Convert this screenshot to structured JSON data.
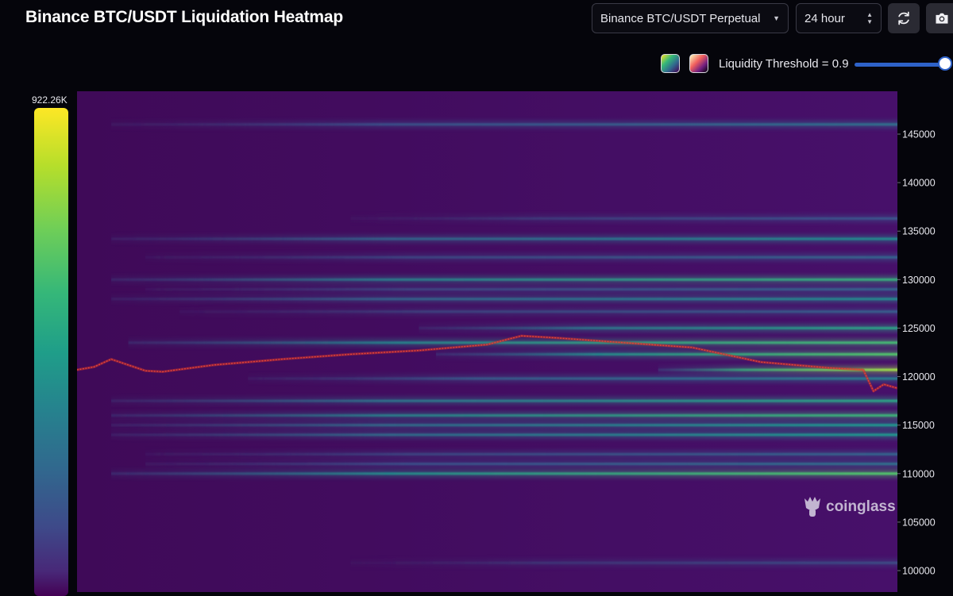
{
  "page": {
    "title": "Binance BTC/USDT Liquidation Heatmap"
  },
  "controls": {
    "market": "Binance BTC/USDT Perpetual",
    "range": "24 hour",
    "threshold_label": "Liquidity Threshold = 0.9",
    "threshold_value": 0.9
  },
  "colors": {
    "accent": "#2e62c9",
    "background": "#05050b",
    "heat_base": "#450c5e"
  },
  "icons": {
    "refresh": "refresh-icon",
    "camera": "camera-icon",
    "logo": "coinglass-logo-icon"
  },
  "watermark": "coinglass",
  "chart_data": {
    "type": "heatmap",
    "title": "Binance BTC/USDT Liquidation Heatmap",
    "colorscale": "viridis",
    "scale_max_label": "922.26K",
    "y_ticks": [
      145000,
      140000,
      135000,
      130000,
      125000,
      120000,
      115000,
      110000,
      105000,
      100000
    ],
    "y_range": [
      98000,
      149500
    ],
    "x_range": [
      0,
      24
    ],
    "grid": false,
    "liquidation_levels": [
      {
        "price": 146000,
        "start": 1.0,
        "intensity": 0.35
      },
      {
        "price": 136300,
        "start": 8.0,
        "intensity": 0.25
      },
      {
        "price": 134200,
        "start": 1.0,
        "intensity": 0.45
      },
      {
        "price": 132300,
        "start": 2.0,
        "intensity": 0.3
      },
      {
        "price": 130000,
        "start": 1.0,
        "intensity": 0.6
      },
      {
        "price": 129000,
        "start": 2.0,
        "intensity": 0.3
      },
      {
        "price": 128000,
        "start": 1.0,
        "intensity": 0.45
      },
      {
        "price": 126700,
        "start": 3.0,
        "intensity": 0.28
      },
      {
        "price": 125000,
        "start": 10.0,
        "intensity": 0.55
      },
      {
        "price": 123500,
        "start": 1.5,
        "intensity": 0.65
      },
      {
        "price": 122300,
        "start": 10.5,
        "intensity": 0.7
      },
      {
        "price": 120700,
        "start": 17.0,
        "intensity": 0.85
      },
      {
        "price": 119800,
        "start": 5.0,
        "intensity": 0.4
      },
      {
        "price": 117500,
        "start": 1.0,
        "intensity": 0.55
      },
      {
        "price": 116000,
        "start": 1.0,
        "intensity": 0.62
      },
      {
        "price": 115000,
        "start": 1.0,
        "intensity": 0.5
      },
      {
        "price": 114000,
        "start": 1.0,
        "intensity": 0.5
      },
      {
        "price": 112000,
        "start": 2.0,
        "intensity": 0.3
      },
      {
        "price": 111000,
        "start": 2.0,
        "intensity": 0.35
      },
      {
        "price": 110000,
        "start": 1.0,
        "intensity": 0.7
      },
      {
        "price": 100800,
        "start": 8.0,
        "intensity": 0.22
      }
    ],
    "price_series": {
      "x": [
        0,
        0.5,
        1,
        2,
        2.5,
        4,
        6,
        8,
        10,
        12,
        13,
        14,
        16,
        18,
        20,
        22,
        23,
        23.3,
        23.6,
        24
      ],
      "y": [
        120700,
        121000,
        121800,
        120600,
        120500,
        121200,
        121800,
        122300,
        122700,
        123300,
        124200,
        124000,
        123500,
        123000,
        121500,
        120900,
        120700,
        118500,
        119200,
        118800
      ]
    }
  }
}
